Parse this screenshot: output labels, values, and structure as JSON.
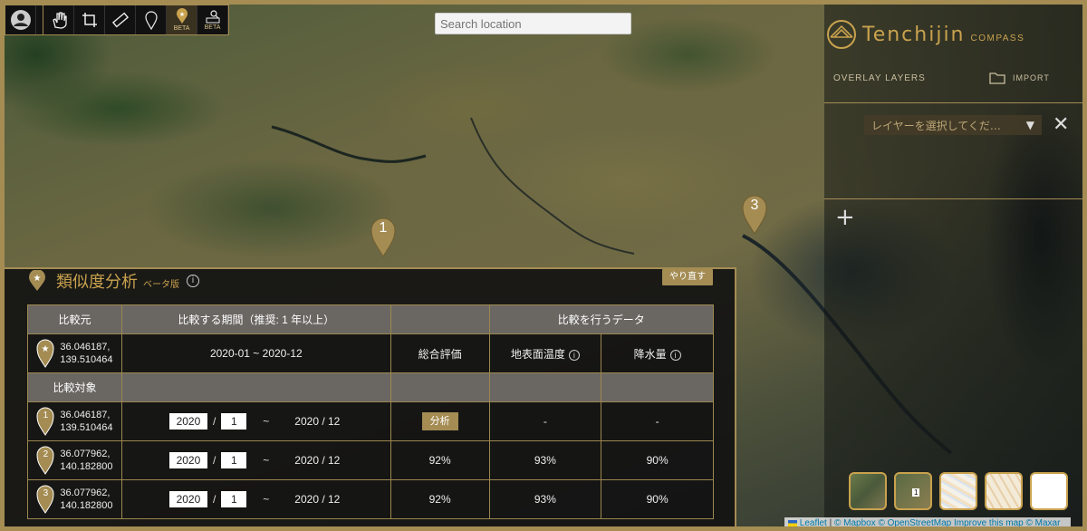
{
  "search": {
    "placeholder": "Search location"
  },
  "toolbar": {
    "tools": [
      {
        "icon": "avatar-icon"
      },
      {
        "icon": "hand-icon"
      },
      {
        "icon": "crop-icon"
      },
      {
        "icon": "ruler-icon"
      },
      {
        "icon": "pin-outline-icon"
      },
      {
        "icon": "star-pin-icon",
        "badge": "BETA"
      },
      {
        "icon": "search-area-icon",
        "badge": "BETA"
      }
    ]
  },
  "right_panel": {
    "brand": "Tenchijin",
    "brand_sub": "COMPASS",
    "overlay_layers": "OVERLAY LAYERS",
    "import": "IMPORT",
    "layer_select": "レイヤーを選択してくだ…",
    "layer_arrow": "▼",
    "close": "✕",
    "add": "+"
  },
  "markers": [
    {
      "label": "1"
    },
    {
      "label": "3"
    }
  ],
  "analysis": {
    "title": "類似度分析",
    "beta": "ベータ版",
    "redo": "やり直す",
    "headers": {
      "source": "比較元",
      "period": "比較する期間（推奨: 1 年以上）",
      "data": "比較を行うデータ",
      "target": "比較対象",
      "overall": "総合評価",
      "surface_temp": "地表面温度",
      "precip": "降水量"
    },
    "source_row": {
      "lat": "36.046187,",
      "lon": "139.510464",
      "period": "2020-01 ~ 2020-12"
    },
    "targets": [
      {
        "num": "1",
        "lat": "36.046187,",
        "lon": "139.510464",
        "year": "2020",
        "month": "1",
        "end": "2020 / 12",
        "overall": "分析",
        "temp": "-",
        "precip": "-"
      },
      {
        "num": "2",
        "lat": "36.077962,",
        "lon": "140.182800",
        "year": "2020",
        "month": "1",
        "end": "2020 / 12",
        "overall": "92%",
        "temp": "93%",
        "precip": "90%"
      },
      {
        "num": "3",
        "lat": "36.077962,",
        "lon": "140.182800",
        "year": "2020",
        "month": "1",
        "end": "2020 / 12",
        "overall": "92%",
        "temp": "93%",
        "precip": "90%"
      }
    ],
    "slash": "/",
    "tilde": "~"
  },
  "attribution": {
    "leaflet": "Leaflet",
    "mapbox": "© Mapbox",
    "osm": "© OpenStreetMap",
    "improve": "Improve this map",
    "maxar": "© Maxar"
  },
  "thumbnails": {
    "badge": "1"
  },
  "colors": {
    "gold": "#a48c53",
    "gold_text": "#c9a24e",
    "header_gray": "#6a6763"
  }
}
